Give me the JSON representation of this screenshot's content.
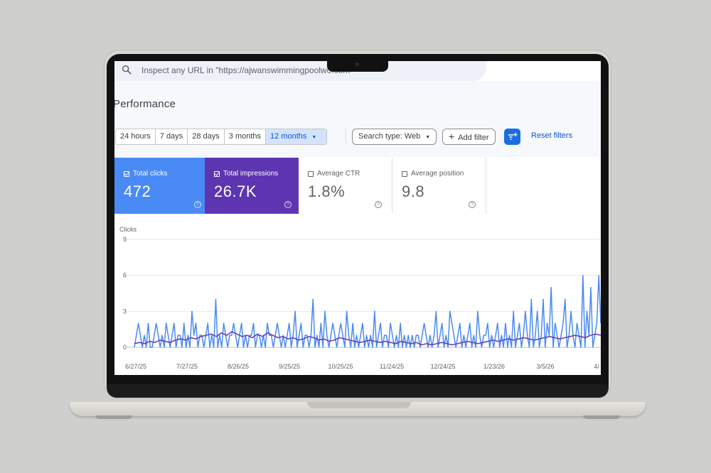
{
  "search": {
    "text": "Inspect any URL in \"https://ajwanswimmingpoolwo.com\""
  },
  "page": {
    "title": "Performance"
  },
  "date_ranges": [
    "24 hours",
    "7 days",
    "28 days",
    "3 months",
    "12 months"
  ],
  "selected_range": "12 months",
  "toolbar": {
    "search_type": "Search type: Web",
    "add_filter": "Add filter",
    "reset_filters": "Reset filters"
  },
  "metrics": {
    "clicks": {
      "label": "Total clicks",
      "value": "472",
      "checked": true,
      "color": "#4a8af4"
    },
    "impressions": {
      "label": "Total impressions",
      "value": "26.7K",
      "checked": true,
      "color": "#5e35b1"
    },
    "ctr": {
      "label": "Average CTR",
      "value": "1.8%",
      "checked": false
    },
    "position": {
      "label": "Average position",
      "value": "9.8",
      "checked": false
    }
  },
  "chart_data": {
    "type": "line",
    "ylabel": "Clicks",
    "yticks": [
      "9",
      "6",
      "3",
      "0"
    ],
    "ylim": [
      0,
      9
    ],
    "x_tick_labels": [
      "6/27/25",
      "7/27/25",
      "8/26/25",
      "9/25/25",
      "10/25/25",
      "11/24/25",
      "12/24/25",
      "1/23/26",
      "3/5/26",
      "4/"
    ],
    "grid": true,
    "series": [
      {
        "color": "#4a8af4",
        "values": [
          0,
          1,
          2,
          1,
          0,
          1,
          0,
          2,
          0,
          0,
          1,
          2,
          1,
          0,
          1,
          0,
          2,
          1,
          0,
          1,
          2,
          0,
          1,
          1,
          0,
          2,
          0,
          1,
          0,
          3,
          1,
          2,
          0,
          1,
          1,
          0,
          1,
          2,
          0,
          1,
          0,
          4,
          0,
          1,
          0,
          2,
          1,
          0,
          1,
          1,
          2,
          1,
          0,
          1,
          2,
          0,
          1,
          0,
          1,
          1,
          2,
          0,
          1,
          1,
          0,
          1,
          0,
          2,
          1,
          1,
          0,
          1,
          2,
          1,
          0,
          1,
          0,
          1,
          2,
          0,
          1,
          3,
          0,
          1,
          2,
          0,
          1,
          1,
          0,
          1,
          4,
          0,
          1,
          0,
          2,
          0,
          3,
          1,
          0,
          1,
          2,
          1,
          0,
          1,
          2,
          1,
          0,
          3,
          1,
          0,
          2,
          0,
          1,
          0,
          1,
          2,
          0,
          1,
          0,
          1,
          0,
          3,
          0,
          1,
          2,
          0,
          1,
          1,
          0,
          2,
          1,
          0,
          1,
          0,
          2,
          0,
          1,
          0,
          1,
          0,
          1,
          0,
          1,
          1,
          0,
          1,
          2,
          1,
          0,
          1,
          0,
          1,
          3,
          0,
          1,
          2,
          0,
          1,
          0,
          3,
          2,
          1,
          0,
          1,
          2,
          0,
          1,
          0,
          1,
          2,
          0,
          1,
          0,
          3,
          1,
          0,
          1,
          1,
          2,
          0,
          1,
          0,
          1,
          2,
          0,
          1,
          0,
          2,
          0,
          1,
          0,
          3,
          0,
          1,
          2,
          0,
          1,
          3,
          1,
          0,
          4,
          0,
          1,
          3,
          0,
          1,
          4,
          0,
          2,
          1,
          5,
          0,
          2,
          1,
          0,
          1,
          2,
          4,
          0,
          1,
          3,
          1,
          0,
          2,
          1,
          0,
          6,
          0,
          3,
          1,
          5,
          0,
          1,
          2,
          6,
          2
        ]
      },
      {
        "color": "#6a3fb8",
        "values": [
          0.3,
          0.4,
          0.3,
          0.5,
          0.4,
          0.6,
          0.5,
          0.4,
          0.6,
          0.7,
          0.6,
          0.8,
          0.7,
          0.9,
          1.0,
          1.1,
          0.9,
          1.2,
          1.0,
          1.3,
          1.1,
          0.9,
          1.0,
          0.8,
          1.1,
          0.9,
          1.2,
          1.0,
          0.8,
          0.9,
          0.7,
          0.8,
          0.6,
          0.7,
          0.9,
          0.8,
          0.6,
          0.7,
          0.5,
          0.6,
          0.8,
          0.7,
          0.6,
          0.5,
          0.4,
          0.5,
          0.6,
          0.5,
          0.4,
          0.5,
          0.4,
          0.3,
          0.5,
          0.4,
          0.3,
          0.4,
          0.2,
          0.3,
          0.2,
          0.3,
          0.4,
          0.3,
          0.2,
          0.3,
          0.4,
          0.5,
          0.4,
          0.3,
          0.4,
          0.5,
          0.6,
          0.5,
          0.6,
          0.7,
          0.6,
          0.7,
          0.8,
          0.7,
          0.6,
          0.7,
          0.8,
          0.9,
          0.8,
          0.7,
          0.8,
          0.9,
          1.0,
          0.9,
          0.8,
          1.0,
          1.1,
          1.0
        ]
      }
    ]
  }
}
